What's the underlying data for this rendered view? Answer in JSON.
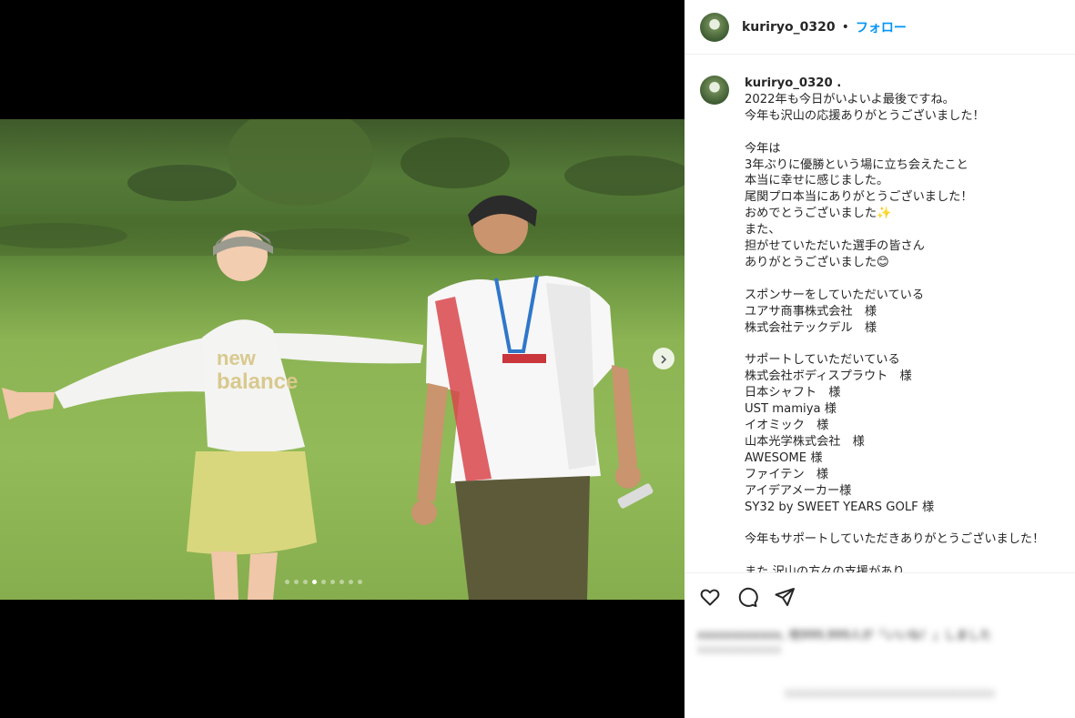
{
  "post": {
    "username": "kuriryo_0320",
    "separator": "•",
    "follow_label": "フォロー",
    "caption_username": "kuriryo_0320 .",
    "caption_lines": [
      "2022年も今日がいよいよ最後ですね。",
      "今年も沢山の応援ありがとうございました！",
      "",
      "今年は",
      "3年ぶりに優勝という場に立ち会えたこと",
      "本当に幸せに感じました。",
      "尾関プロ本当にありがとうございました！",
      "おめでとうございました✨",
      "また、",
      "担がせていただいた選手の皆さん",
      "ありがとうございました😊",
      "",
      "スポンサーをしていただいている",
      "ユアサ商事株式会社　様",
      "株式会社テックデル　様",
      "",
      "サポートしていただいている",
      "株式会社ボディスプラウト　様",
      "日本シャフト　様",
      "UST mamiya 様",
      "イオミック　様",
      "山本光学株式会社　様",
      "AWESOME 様",
      "ファイテン　様",
      "アイデアメーカー様",
      "SY32 by SWEET YEARS GOLF 様",
      "",
      "今年もサポートしていただきありがとうございました！",
      "",
      "また 沢山の方々の支援があり"
    ]
  },
  "carousel": {
    "dot_count": 9,
    "active_index": 3,
    "next_icon": "chevron-right-icon"
  },
  "actions": {
    "like_icon": "heart-icon",
    "comment_icon": "comment-icon",
    "share_icon": "paper-plane-icon"
  },
  "blurred": {
    "line1": "xxxxxxxxxxxx, 他999,999人が「いいね！」しました",
    "line2": "xxxxxxxxxxxx",
    "line3": "xxxxxxxxxxxxxxxxxxxxxxxxxxxxxx"
  },
  "colors": {
    "follow": "#0095f6",
    "text": "#262626",
    "border": "#efefef"
  }
}
